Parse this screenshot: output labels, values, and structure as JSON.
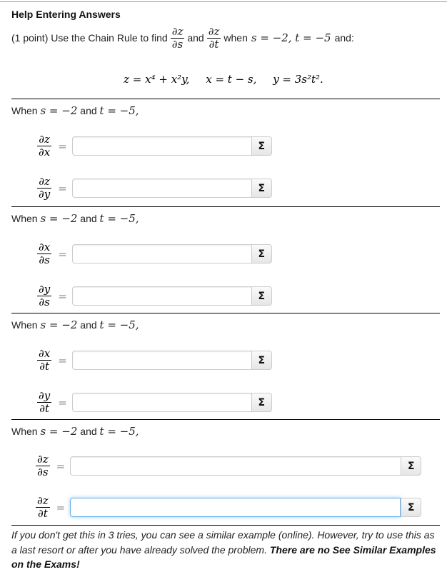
{
  "header": {
    "title": "Help Entering Answers"
  },
  "problem": {
    "prefix": "(1 point) Use the Chain Rule to find",
    "frac1": {
      "num": "∂z",
      "den": "∂s"
    },
    "and": "and",
    "frac2": {
      "num": "∂z",
      "den": "∂t"
    },
    "when_text": "when",
    "cond": "s = −2, t = −5",
    "suffix": "and:"
  },
  "equations": [
    "z = x⁴ + x²y,",
    "x = t − s,",
    "y = 3s²t²."
  ],
  "groups": [
    {
      "when_prefix": "When",
      "s_expr": "s = −2",
      "and": "and",
      "t_expr": "t = −5,",
      "rows": [
        {
          "num": "∂z",
          "den": "∂x",
          "value": "",
          "sigma": "Σ"
        },
        {
          "num": "∂z",
          "den": "∂y",
          "value": "",
          "sigma": "Σ"
        }
      ]
    },
    {
      "when_prefix": "When",
      "s_expr": "s = −2",
      "and": "and",
      "t_expr": "t = −5,",
      "rows": [
        {
          "num": "∂x",
          "den": "∂s",
          "value": "",
          "sigma": "Σ"
        },
        {
          "num": "∂y",
          "den": "∂s",
          "value": "",
          "sigma": "Σ"
        }
      ]
    },
    {
      "when_prefix": "When",
      "s_expr": "s = −2",
      "and": "and",
      "t_expr": "t = −5,",
      "rows": [
        {
          "num": "∂x",
          "den": "∂t",
          "value": "",
          "sigma": "Σ"
        },
        {
          "num": "∂y",
          "den": "∂t",
          "value": "",
          "sigma": "Σ"
        }
      ]
    },
    {
      "when_prefix": "When",
      "s_expr": "s = −2",
      "and": "and",
      "t_expr": "t = −5,",
      "rows": [
        {
          "num": "∂z",
          "den": "∂s",
          "value": "",
          "sigma": "Σ"
        },
        {
          "num": "∂z",
          "den": "∂t",
          "value": "",
          "sigma": "Σ",
          "focused": true
        }
      ]
    }
  ],
  "note": {
    "italic": "If you don't get this in 3 tries, you can see a similar example (online). However, try to use this as a last resort or after you have already solved the problem.",
    "bold": "There are no See Similar Examples on the Exams!"
  }
}
